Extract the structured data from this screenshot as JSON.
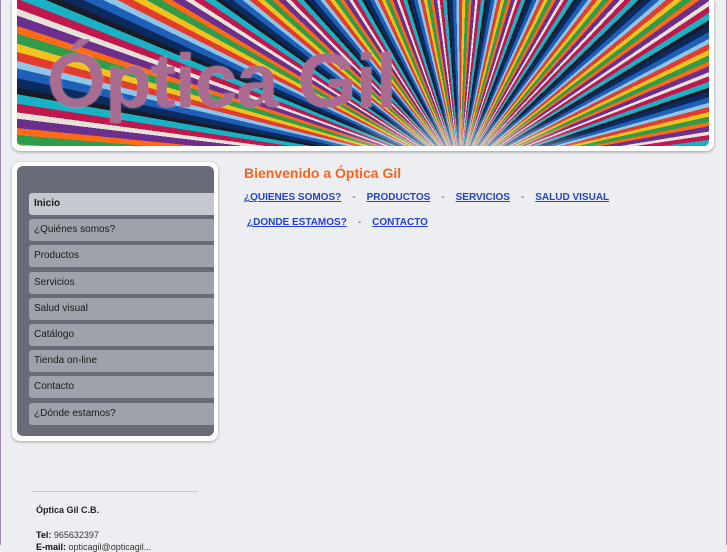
{
  "header": {
    "title": "Óptica Gil"
  },
  "sidebar": {
    "items": [
      {
        "label": "Inicio",
        "active": true
      },
      {
        "label": "¿Quiénes somos?",
        "active": false
      },
      {
        "label": "Productos",
        "active": false
      },
      {
        "label": "Servicios",
        "active": false
      },
      {
        "label": "Salud visual",
        "active": false
      },
      {
        "label": "Catálogo",
        "active": false
      },
      {
        "label": "Tienda on-line",
        "active": false
      },
      {
        "label": "Contacto",
        "active": false
      },
      {
        "label": "¿Dónde estamos?",
        "active": false
      }
    ]
  },
  "main": {
    "welcome": "Bienvenido a Óptica Gil",
    "separator": "-",
    "links_row1": [
      "¿QUIENES SOMOS?",
      "PRODUCTOS",
      "SERVICIOS",
      "SALUD VISUAL"
    ],
    "links_row2": [
      "¿DONDE ESTAMOS?",
      "CONTACTO"
    ]
  },
  "footer": {
    "company": "Óptica Gil C.B.",
    "tel_label": "Tel:",
    "tel_value": "965632397",
    "email_label": "E-mail:",
    "email_value": "opticagil@opticagil..."
  },
  "colors": {
    "accent": "#f0661f",
    "link": "#2244cc",
    "logo_text": "#a96b8f",
    "sidebar_bg": "#676c76",
    "page_bg": "#eceef1"
  },
  "icons": {
    "banner": "radiating-color-rays-image"
  }
}
